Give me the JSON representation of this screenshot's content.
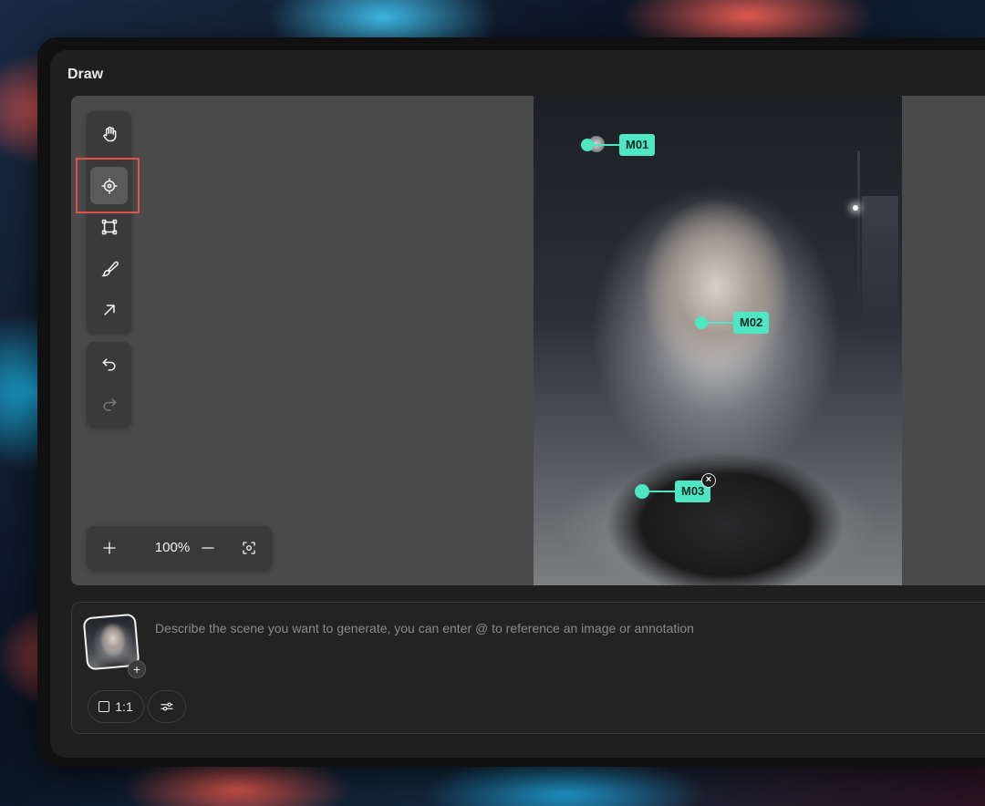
{
  "window": {
    "title": "Draw"
  },
  "toolbar": {
    "tools": [
      {
        "name": "hand-tool",
        "icon": "hand-icon",
        "active": false
      },
      {
        "name": "target-tool",
        "icon": "target-icon",
        "active": true
      },
      {
        "name": "select-tool",
        "icon": "bounding-box-icon",
        "active": false
      },
      {
        "name": "brush-tool",
        "icon": "brush-icon",
        "active": false
      },
      {
        "name": "arrow-tool",
        "icon": "arrow-icon",
        "active": false
      }
    ],
    "history": [
      {
        "name": "undo",
        "icon": "undo-icon",
        "enabled": true
      },
      {
        "name": "redo",
        "icon": "redo-icon",
        "enabled": false
      }
    ]
  },
  "zoom": {
    "value": "100%",
    "zoom_in_icon": "plus-icon",
    "zoom_out_icon": "minus-icon",
    "fit_icon": "fit-screen-icon"
  },
  "annotations": [
    {
      "label": "M01"
    },
    {
      "label": "M02"
    },
    {
      "label": "M03"
    }
  ],
  "prompt": {
    "placeholder": "Describe the scene you want to generate, you can enter @ to reference an image or annotation",
    "value": "",
    "add_icon": "+",
    "aspect_ratio": "1:1",
    "settings_icon": "sliders-icon"
  },
  "colors": {
    "accent": "#4ee6c3",
    "highlight": "#e5514a",
    "panel": "#1f1f1f",
    "canvas": "#4a4a4a"
  }
}
